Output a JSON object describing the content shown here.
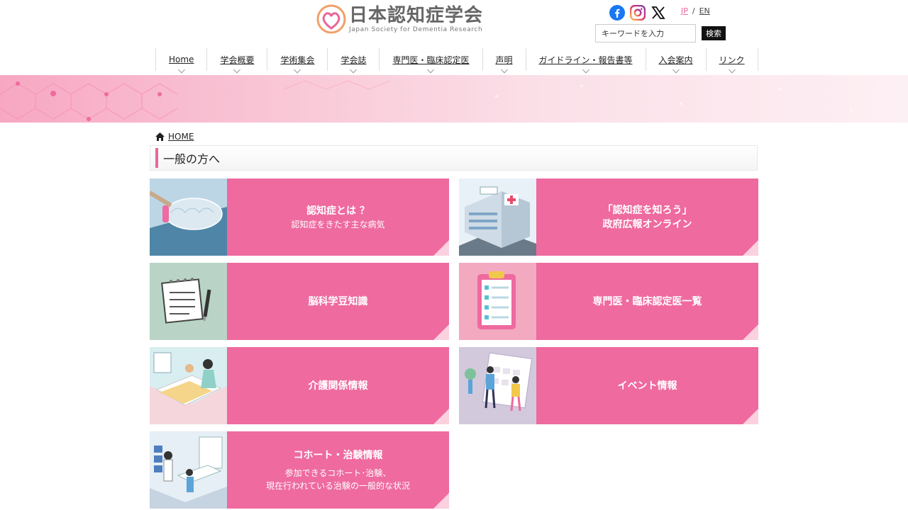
{
  "header": {
    "logo_title": "日本認知症学会",
    "logo_subtitle": "Japan Society for Dementia Research",
    "lang_jp": "JP",
    "lang_sep": "/",
    "lang_en": "EN",
    "search_placeholder": "キーワードを入力",
    "search_button": "検索",
    "social": [
      "facebook-icon",
      "instagram-icon",
      "x-icon"
    ]
  },
  "nav": {
    "items": [
      "Home",
      "学会概要",
      "学術集会",
      "学会誌",
      "専門医・臨床認定医",
      "声明",
      "ガイドライン・報告書等",
      "入会案内",
      "リンク"
    ]
  },
  "breadcrumb": {
    "home": "HOME"
  },
  "page": {
    "title": "一般の方へ"
  },
  "cards": [
    {
      "title": "認知症とは ？",
      "subtitle": "認知症をきたす主な病気"
    },
    {
      "title": "「認知症を知ろう」",
      "subtitle": "政府広報オンライン"
    },
    {
      "title": "脳科学豆知識",
      "subtitle": ""
    },
    {
      "title": "専門医・臨床認定医一覧",
      "subtitle": ""
    },
    {
      "title": "介護関係情報",
      "subtitle": ""
    },
    {
      "title": "イベント情報",
      "subtitle": ""
    },
    {
      "title": "コホート・治験情報",
      "subtitle": "参加できるコホート･治験、",
      "subtitle2": "現在行われている治験の一般的な状況"
    }
  ],
  "colors": {
    "accent": "#ee6a9f",
    "corner": "#fbd0df",
    "brand_pink": "#e8679a"
  }
}
